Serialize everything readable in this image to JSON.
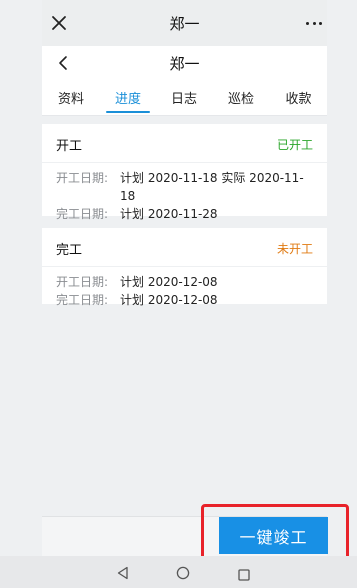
{
  "topbar": {
    "title": "郑一"
  },
  "navbar": {
    "title": "郑一"
  },
  "tabs": [
    {
      "label": "资料",
      "active": false
    },
    {
      "label": "进度",
      "active": true
    },
    {
      "label": "日志",
      "active": false
    },
    {
      "label": "巡检",
      "active": false
    },
    {
      "label": "收款",
      "active": false
    }
  ],
  "cards": [
    {
      "title": "开工",
      "status": "已开工",
      "rows": [
        {
          "label": "开工日期:",
          "value": "计划 2020-11-18 实际 2020-11-18"
        },
        {
          "label": "完工日期:",
          "value": "计划 2020-11-28"
        }
      ]
    },
    {
      "title": "完工",
      "status": "未开工",
      "rows": [
        {
          "label": "开工日期:",
          "value": "计划 2020-12-08"
        },
        {
          "label": "完工日期:",
          "value": "计划 2020-12-08"
        }
      ]
    }
  ],
  "actions": {
    "finish_label": "一键竣工"
  },
  "colors": {
    "accent": "#1a8fd8",
    "status_done": "#2aa52a",
    "status_todo": "#e07a12",
    "highlight": "#e8222a"
  },
  "icons": {
    "close": "close-icon",
    "more": "more-icon",
    "back": "chevron-left-icon",
    "sys_back": "triangle-back-icon",
    "sys_home": "circle-home-icon",
    "sys_recent": "square-recent-icon"
  }
}
